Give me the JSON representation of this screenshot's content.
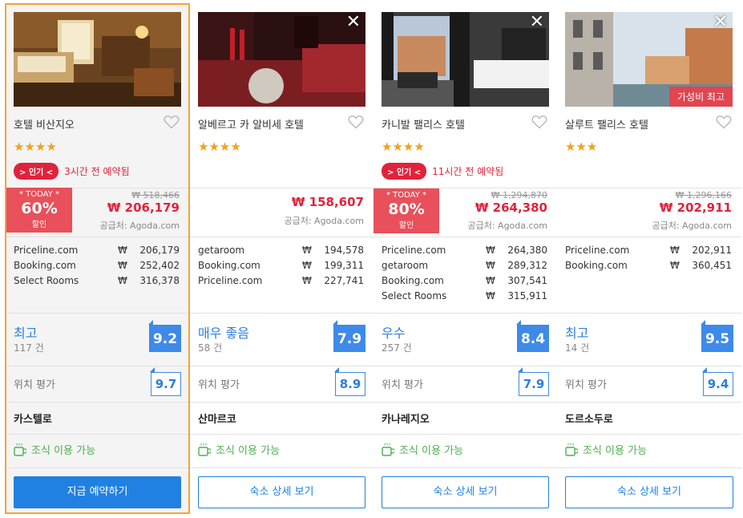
{
  "hotels": [
    {
      "name": "호텔 비산지오",
      "stars": "★★★★",
      "popular": {
        "pill": "> 인기 <",
        "text": "3시간 전 예약됨"
      },
      "deal": {
        "today": "* TODAY *",
        "percent": "60%",
        "label": "할인"
      },
      "old_price": "₩ 518,466",
      "price": "₩ 206,179",
      "supplier": "공급처: Agoda.com",
      "offers": [
        {
          "source": "Priceline.com",
          "currency": "₩",
          "amount": "206,179"
        },
        {
          "source": "Booking.com",
          "currency": "₩",
          "amount": "252,402"
        },
        {
          "source": "Select Rooms",
          "currency": "₩",
          "amount": "316,378"
        }
      ],
      "rating_word": "최고",
      "rating_count": "117 건",
      "score": "9.2",
      "location_label": "위치 평가",
      "location_score": "9.7",
      "district": "카스텔로",
      "breakfast": "조식 이용 가능",
      "button": "지금 예약하기"
    },
    {
      "name": "알베르고 카 알비세 호텔",
      "stars": "★★★★",
      "price": "₩ 158,607",
      "supplier": "공급처: Agoda.com",
      "offers": [
        {
          "source": "getaroom",
          "currency": "₩",
          "amount": "194,578"
        },
        {
          "source": "Booking.com",
          "currency": "₩",
          "amount": "199,311"
        },
        {
          "source": "Priceline.com",
          "currency": "₩",
          "amount": "227,741"
        }
      ],
      "rating_word": "매우 좋음",
      "rating_count": "58 건",
      "score": "7.9",
      "location_label": "위치 평가",
      "location_score": "8.9",
      "district": "산마르코",
      "breakfast": "조식 이용 가능",
      "button": "숙소 상세 보기"
    },
    {
      "name": "카니발 팰리스 호텔",
      "stars": "★★★★",
      "popular": {
        "pill": "> 인기 <",
        "text": "11시간 전 예약됨"
      },
      "deal": {
        "today": "* TODAY *",
        "percent": "80%",
        "label": "할인"
      },
      "old_price": "₩ 1,294,870",
      "price": "₩ 264,380",
      "supplier": "공급처: Agoda.com",
      "offers": [
        {
          "source": "Priceline.com",
          "currency": "₩",
          "amount": "264,380"
        },
        {
          "source": "getaroom",
          "currency": "₩",
          "amount": "289,312"
        },
        {
          "source": "Booking.com",
          "currency": "₩",
          "amount": "307,541"
        },
        {
          "source": "Select Rooms",
          "currency": "₩",
          "amount": "315,911"
        }
      ],
      "rating_word": "우수",
      "rating_count": "257 건",
      "score": "8.4",
      "location_label": "위치 평가",
      "location_score": "7.9",
      "district": "카나레지오",
      "breakfast": "조식 이용 가능",
      "button": "숙소 상세 보기"
    },
    {
      "name": "살루트 팰리스 호텔",
      "stars": "★★★",
      "badge": "가성비 최고",
      "old_price": "₩ 1,296,166",
      "price": "₩ 202,911",
      "supplier": "공급처: Agoda.com",
      "offers": [
        {
          "source": "Priceline.com",
          "currency": "₩",
          "amount": "202,911"
        },
        {
          "source": "Booking.com",
          "currency": "₩",
          "amount": "360,451"
        }
      ],
      "rating_word": "최고",
      "rating_count": "14 건",
      "score": "9.5",
      "location_label": "위치 평가",
      "location_score": "9.4",
      "district": "도르소두로",
      "breakfast": "조식 이용 가능",
      "button": "숙소 상세 보기"
    }
  ],
  "icons": {
    "close": "close-icon",
    "favorite": "heart-icon",
    "breakfast": "coffee-cup-icon"
  },
  "colors": {
    "accent": "#2081e2",
    "deal": "#e8505b",
    "popular": "#e0233b",
    "star": "#f0a21b",
    "breakfast": "#4caf50",
    "selected_border": "#f5a335"
  }
}
